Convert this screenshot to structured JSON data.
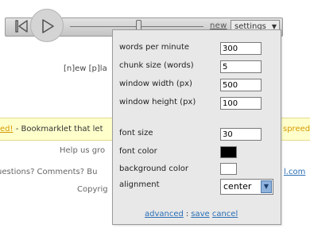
{
  "player": {
    "new_label": "new",
    "settings_label": "settings",
    "settings_arrow": "▼"
  },
  "background": {
    "tagline": "[n]ew [p]la",
    "yellow_link": "ed!",
    "yellow_text": " - Bookmarklet that let",
    "yellow_right": "spreede",
    "help": "Help us gro",
    "questions": "uestions? Comments? Bu",
    "com": "l.com",
    "copyright": "Copyrig"
  },
  "settings": {
    "rows": [
      {
        "label": "words per minute",
        "value": "300"
      },
      {
        "label": "chunk size (words)",
        "value": "5"
      },
      {
        "label": "window width (px)",
        "value": "500"
      },
      {
        "label": "window height (px)",
        "value": "100"
      },
      {
        "label": "font size",
        "value": "30"
      }
    ],
    "font_color_label": "font color",
    "font_color": "#000000",
    "background_color_label": "background color",
    "background_color": "#ffffff",
    "alignment_label": "alignment",
    "alignment_value": "center",
    "advanced_label": "advanced",
    "separator": ":",
    "save_label": "save",
    "cancel_label": "cancel"
  },
  "colors": {
    "accent_link": "#2a6fb5",
    "yellow_bar": "#ffffcc",
    "panel_bg": "#e8e8e8"
  }
}
